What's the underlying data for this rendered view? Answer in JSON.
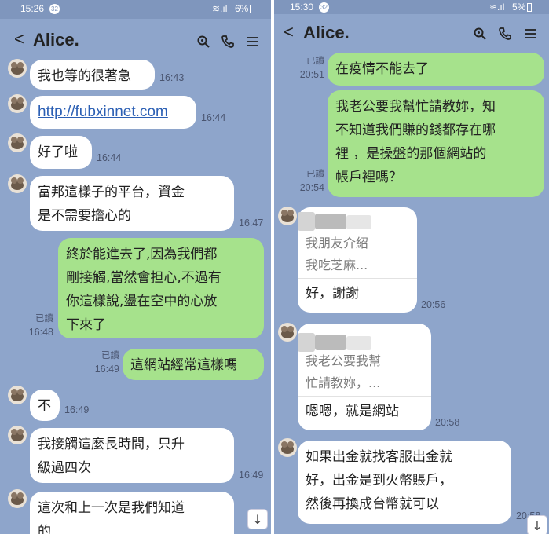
{
  "left": {
    "status": {
      "time": "15:26",
      "notif": "32",
      "battery": "6%"
    },
    "header": {
      "back": "<",
      "title": "Alice."
    },
    "messages": [
      {
        "text": "我也等的很著急",
        "time": "16:43"
      },
      {
        "text": "http://fubxinnet.com",
        "time": "16:44"
      },
      {
        "text": "好了啦",
        "time": "16:44"
      },
      {
        "line1": "富邦這樣子的平台，資金",
        "line2": "是不需要擔心的",
        "time": "16:47"
      },
      {
        "line1": "終於能進去了,因為我們都",
        "line2": "剛接觸,當然會担心,不過有",
        "line3": "你這樣說,盪在空中的心放",
        "line4": "下來了",
        "read": "已讀",
        "time": "16:48"
      },
      {
        "text": "這網站經常這樣嗎",
        "read": "已讀",
        "time": "16:49"
      },
      {
        "text": "不",
        "time": "16:49"
      },
      {
        "line1": "我接觸這麼長時間，只升",
        "line2": "級過四次",
        "time": "16:49"
      },
      {
        "line1": "這次和上一次是我們知道",
        "line2": "的"
      }
    ],
    "scroll_icon": "↓"
  },
  "right": {
    "status": {
      "time": "15:30",
      "notif": "32",
      "battery": "5%"
    },
    "header": {
      "back": "<",
      "title": "Alice."
    },
    "messages": [
      {
        "text": "在疫情不能去了",
        "read": "已讀",
        "time": "20:51"
      },
      {
        "line1": "我老公要我幫忙請教妳，知",
        "line2": "不知道我們賺的錢都存在哪",
        "line3": "裡 ，是操盤的那個網站的",
        "line4": "帳戶裡嗎？",
        "read": "已讀",
        "time": "20:54"
      },
      {
        "quote1": "我朋友介紹",
        "quote2": "我吃芝麻...",
        "reply": "好，謝謝",
        "time": "20:56"
      },
      {
        "quote1": "我老公要我幫",
        "quote2": "忙請教妳，...",
        "reply": "嗯嗯，就是網站",
        "time": "20:58"
      },
      {
        "line1": "如果出金就找客服出金就",
        "line2": "好，出金是到火幣賬戶，",
        "line3": "然後再換成台幣就可以",
        "time": "20:58"
      }
    ],
    "scroll_icon": "↓"
  },
  "colors": {
    "chat_bg": "#8ea5cb",
    "outgoing": "#a6e28c",
    "incoming": "#ffffff",
    "link": "#2b5fb4"
  }
}
